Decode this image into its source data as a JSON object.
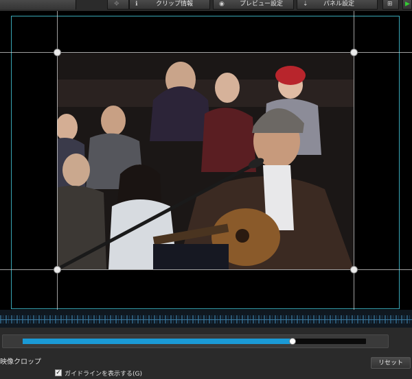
{
  "toolbar": {
    "clip_info_label": "クリップ情報",
    "preview_settings_label": "プレビュー設定",
    "panel_settings_label": "パネル設定",
    "icons": {
      "move": "move-icon",
      "clip_info": "info-icon",
      "preview_settings": "eye-icon",
      "panel_settings": "panel-sort-icon",
      "add": "add-icon",
      "status": "green-arrow-icon"
    }
  },
  "crop": {
    "section_title": "映像クロップ",
    "show_guides_label": "ガイドラインを表示する(G)",
    "show_guides_checked": true,
    "reset_label": "リセット",
    "slider_value_fraction": 0.785
  },
  "colors": {
    "accent": "#1a9ad6",
    "guide_frame": "#3aa8b8"
  }
}
